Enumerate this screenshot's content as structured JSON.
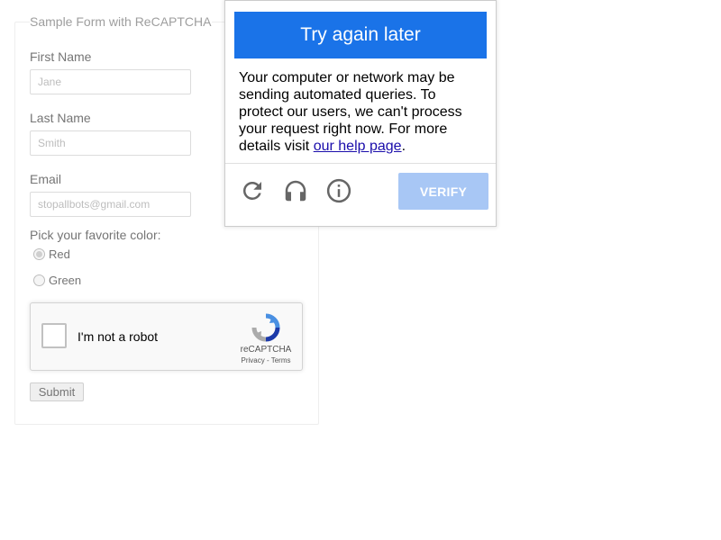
{
  "form": {
    "legend": "Sample Form with ReCAPTCHA",
    "first_name": {
      "label": "First Name",
      "placeholder": "Jane"
    },
    "last_name": {
      "label": "Last Name",
      "placeholder": "Smith"
    },
    "email": {
      "label": "Email",
      "placeholder": "stopallbots@gmail.com"
    },
    "color_question": "Pick your favorite color:",
    "color_options": [
      {
        "label": "Red",
        "checked": true
      },
      {
        "label": "Green",
        "checked": false
      }
    ],
    "submit_label": "Submit"
  },
  "recaptcha": {
    "checkbox_label": "I'm not a robot",
    "brand": "reCAPTCHA",
    "terms": "Privacy - Terms"
  },
  "challenge": {
    "header": "Try again later",
    "message": "Your computer or network may be sending automated queries. To protect our users, we can't process your request right now. For more details visit ",
    "link_text": "our help page",
    "message_end": ".",
    "verify_label": "VERIFY",
    "icons": [
      "reload-icon",
      "headphones-icon",
      "info-icon"
    ],
    "accent_color": "#1a73e8",
    "verify_color": "#a8c7f5"
  }
}
